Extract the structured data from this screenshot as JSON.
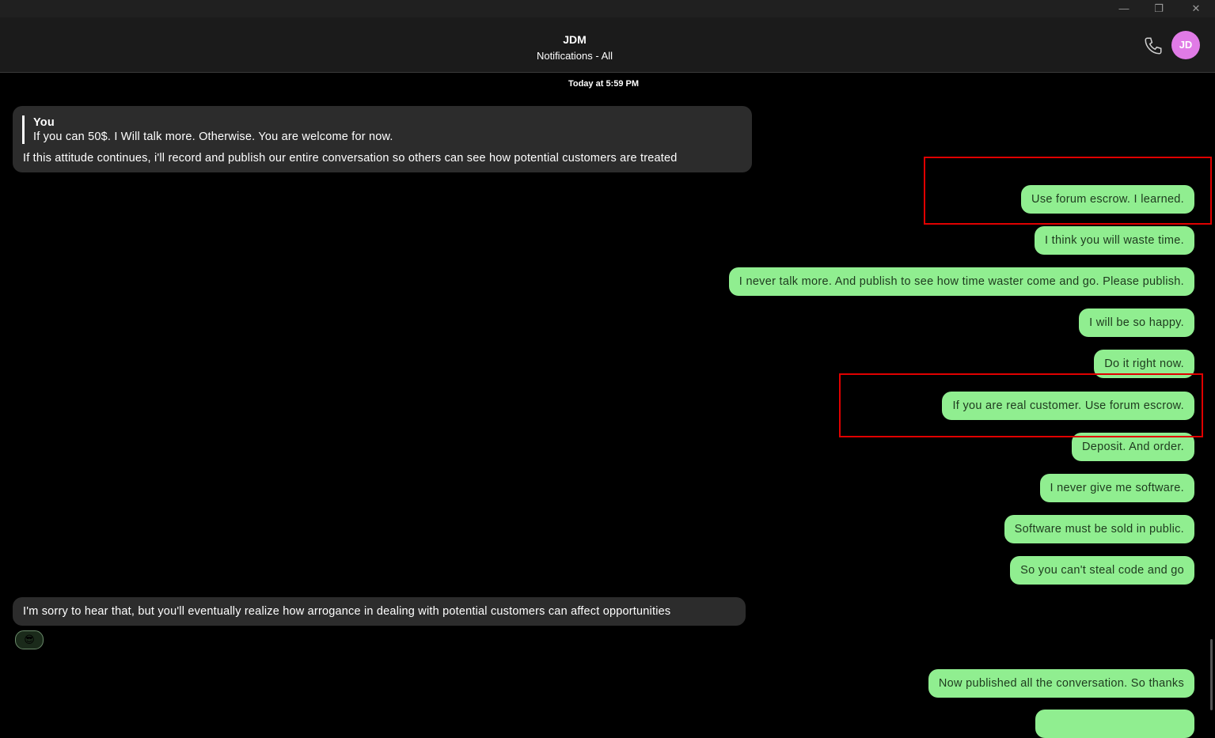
{
  "header": {
    "contact_name": "JDM",
    "subtitle": "Notifications - All",
    "avatar_initials": "JD"
  },
  "conversation": {
    "timestamp": "Today at 5:59 PM",
    "incoming": [
      {
        "quote_author": "You",
        "quote_text": "If you can 50$.  I Will talk more. Otherwise. You are welcome for now.",
        "text": "If this attitude continues, i'll record and publish our entire conversation so others can see how potential customers are treated"
      },
      {
        "text": "I'm sorry to hear that, but you'll eventually realize how arrogance in dealing with potential customers can affect opportunities",
        "reaction": "😎"
      }
    ],
    "outgoing": [
      "Use forum escrow.  I learned.",
      "I think you will waste time.",
      "I never talk more. And publish to see how time waster come and go. Please publish.",
      "I will be so happy.",
      "Do it right now.",
      "If you are real customer. Use forum escrow.",
      "Deposit. And order.",
      "I never give me software.",
      "Software must be sold in public.",
      "So you can't steal code and go",
      "Now published all the conversation.  So thanks"
    ]
  },
  "colors": {
    "outgoing_bubble": "#90ee90",
    "incoming_bubble": "#2c2c2c",
    "avatar": "#e07be6",
    "highlight": "#e00000"
  }
}
